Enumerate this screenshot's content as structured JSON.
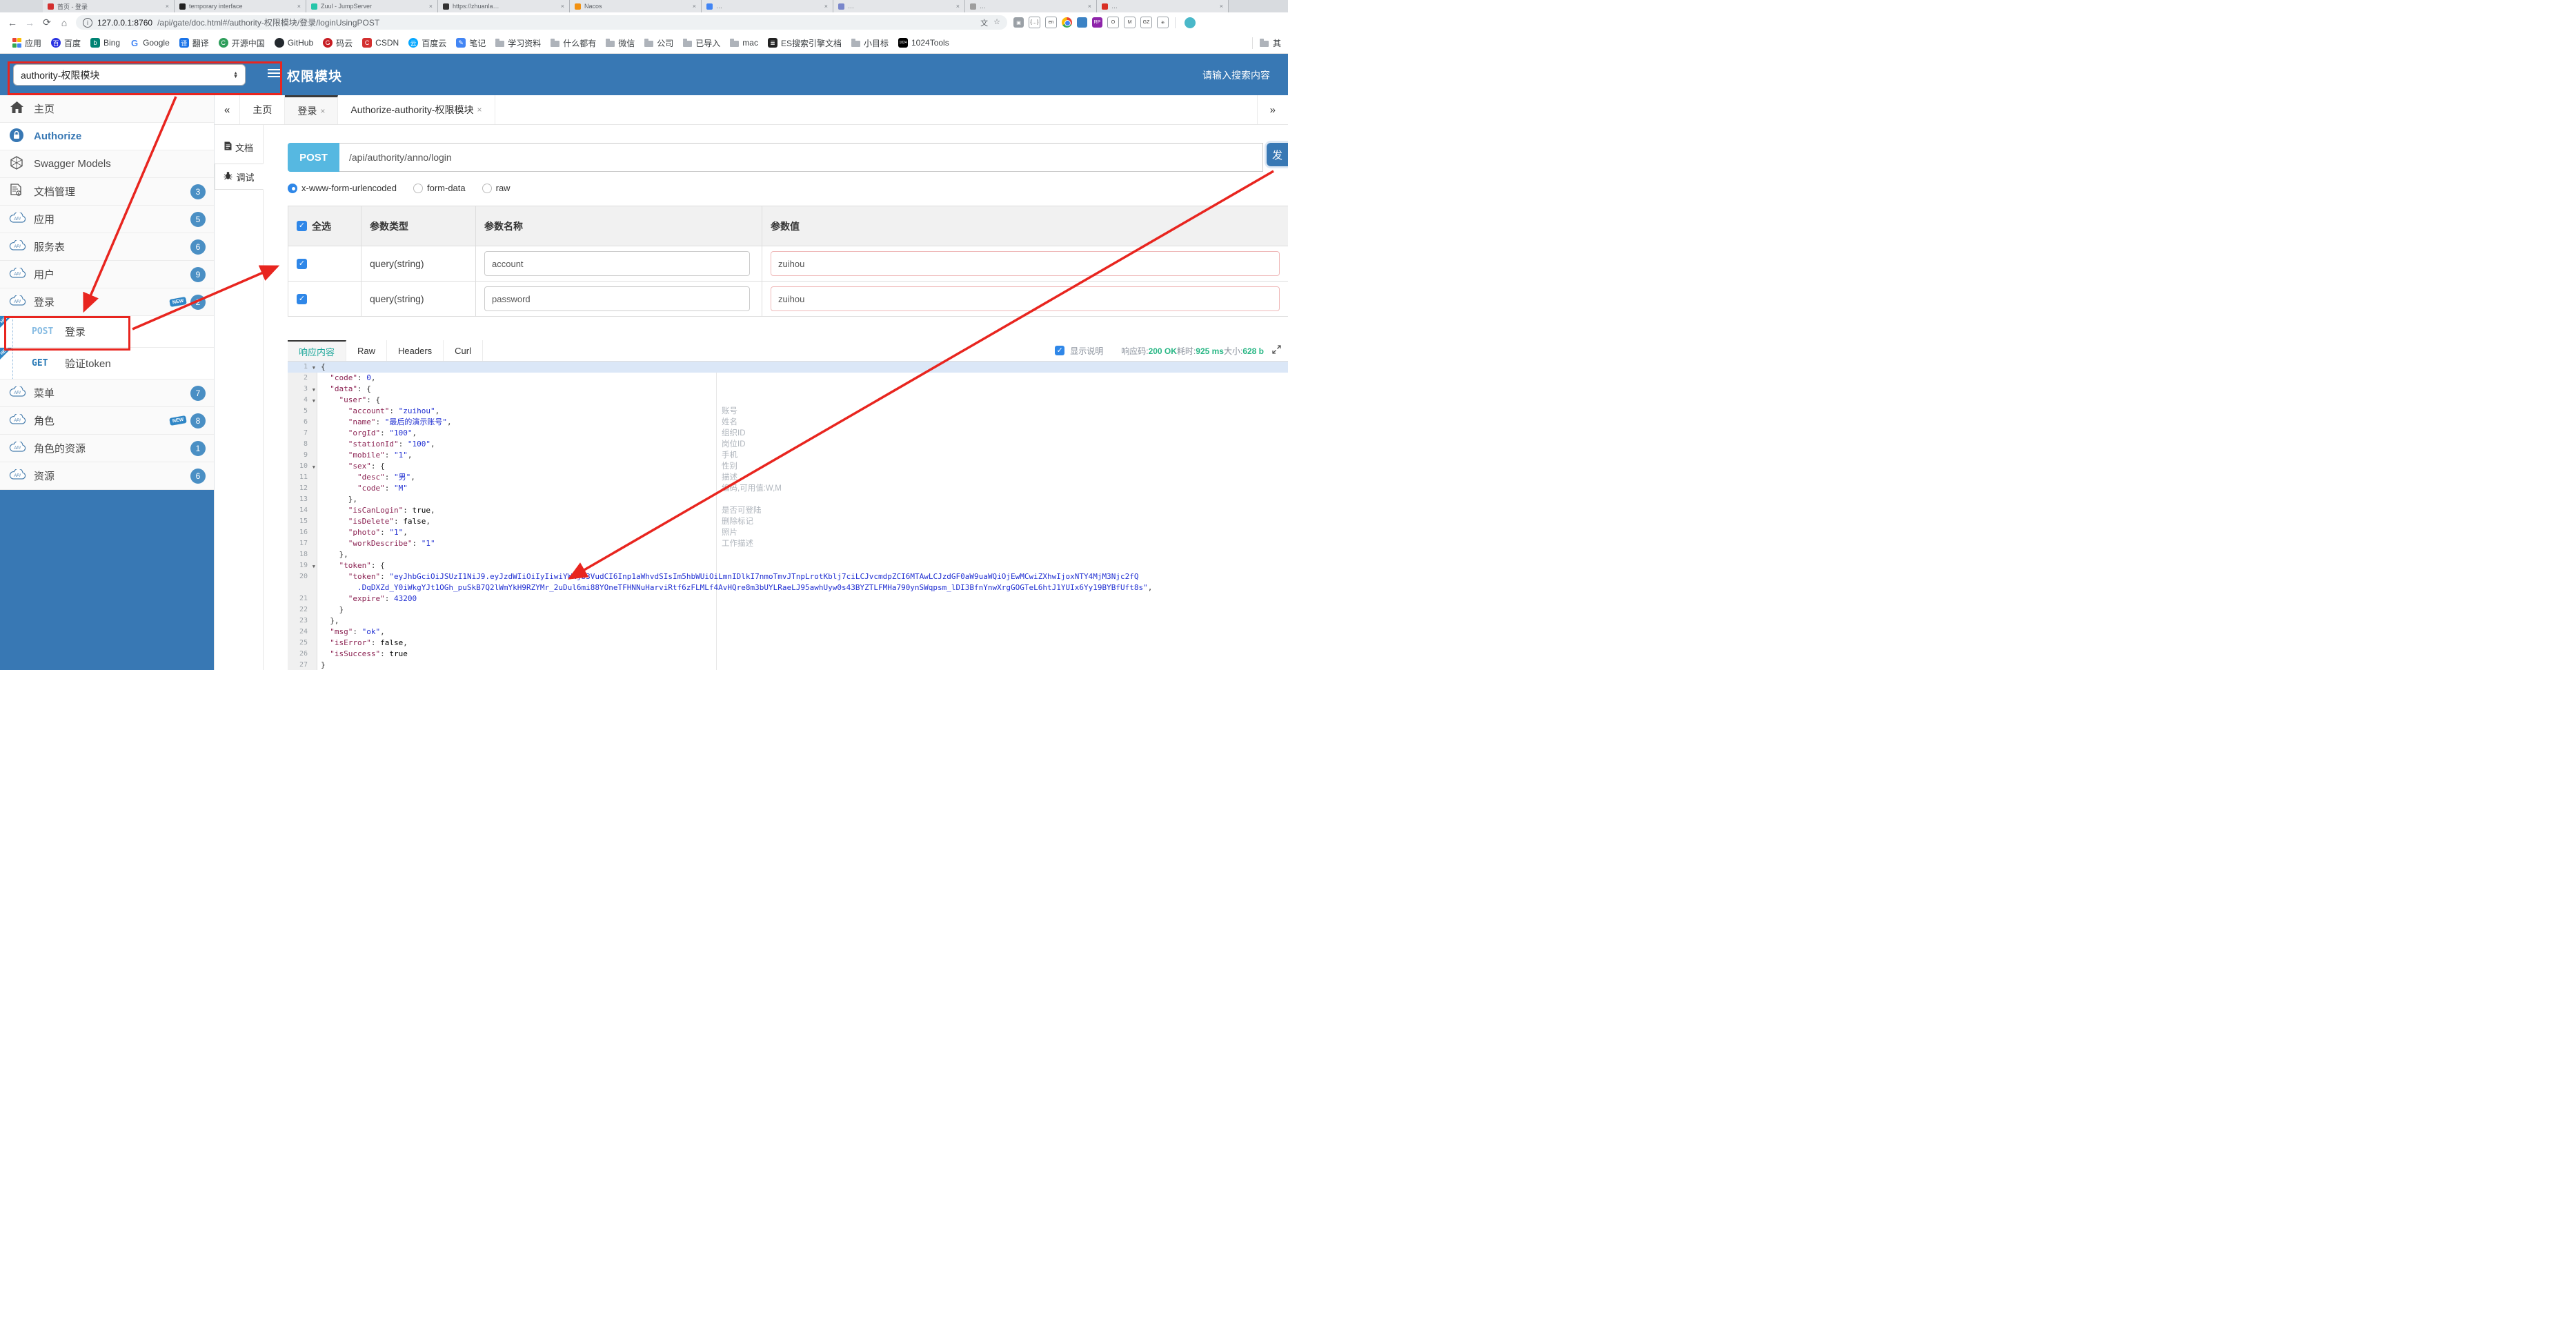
{
  "browser": {
    "tabs": [
      {
        "title": "首页 - 登录",
        "color": "#d32f2f"
      },
      {
        "title": "temporary interface",
        "color": "#222222"
      },
      {
        "title": "Zuul - JumpServer",
        "color": "#26c6aa"
      },
      {
        "title": "https://zhuanla…",
        "color": "#333333"
      },
      {
        "title": "Nacos",
        "color": "#f29111"
      },
      {
        "title": "…",
        "color": "#4285f4"
      },
      {
        "title": "…",
        "color": "#7986cb"
      },
      {
        "title": "…",
        "color": "#9e9e9e"
      },
      {
        "title": "…",
        "color": "#d93025"
      }
    ],
    "close_glyph": "×",
    "nav": {
      "back": "←",
      "forward": "→",
      "reload": "⟳",
      "home": "⌂"
    },
    "url_info": "i",
    "url_host": "127.0.0.1:8760",
    "url_path": "/api/gate/doc.html#/authority-权限模块/登录/loginUsingPOST",
    "translate_icon": "文",
    "star_icon": "☆",
    "extensions": [
      {
        "ch": "▣",
        "bg": "#9aa0a6",
        "style": "fill"
      },
      {
        "ch": "{…}",
        "bg": "",
        "style": "line"
      },
      {
        "ch": "en",
        "bg": "",
        "style": "line"
      },
      {
        "ch": "",
        "bg": "",
        "style": "ball"
      },
      {
        "ch": "",
        "bg": "#3b82c4",
        "style": "fill"
      },
      {
        "ch": "RP",
        "bg": "#8e24aa",
        "style": "fill"
      },
      {
        "ch": "O",
        "bg": "",
        "style": "line"
      },
      {
        "ch": "M",
        "bg": "",
        "style": "line"
      },
      {
        "ch": "GZ",
        "bg": "",
        "style": "line"
      },
      {
        "ch": "✳",
        "bg": "",
        "style": "line"
      }
    ],
    "bookmarks": [
      {
        "t": "grid",
        "label": "应用"
      },
      {
        "t": "circ",
        "bg": "#2932e1",
        "ch": "百",
        "label": "百度"
      },
      {
        "t": "sq",
        "bg": "#008373",
        "ch": "b",
        "label": "Bing"
      },
      {
        "t": "g",
        "ch": "G",
        "label": "Google"
      },
      {
        "t": "sq",
        "bg": "#1a73e8",
        "ch": "译",
        "label": "翻译"
      },
      {
        "t": "circ",
        "bg": "#2e9e5b",
        "ch": "C",
        "label": "开源中国"
      },
      {
        "t": "circ",
        "bg": "#24292e",
        "ch": "",
        "label": "GitHub"
      },
      {
        "t": "circ",
        "bg": "#c71d23",
        "ch": "G",
        "label": "码云"
      },
      {
        "t": "sq",
        "bg": "#d32f2f",
        "ch": "C",
        "label": "CSDN"
      },
      {
        "t": "circ",
        "bg": "#06a7ff",
        "ch": "云",
        "label": "百度云"
      },
      {
        "t": "sq",
        "bg": "#4285f4",
        "ch": "✎",
        "label": "笔记"
      },
      {
        "t": "folder",
        "label": "学习资料"
      },
      {
        "t": "folder",
        "label": "什么都有"
      },
      {
        "t": "folder",
        "label": "微信"
      },
      {
        "t": "folder",
        "label": "公司"
      },
      {
        "t": "folder",
        "label": "已导入"
      },
      {
        "t": "folder",
        "label": "mac"
      },
      {
        "t": "sq",
        "bg": "#222222",
        "ch": "≣",
        "label": "ES搜索引擎文档"
      },
      {
        "t": "folder",
        "label": "小目标"
      },
      {
        "t": "sq",
        "bg": "#000000",
        "ch": "1024",
        "label": "1024Tools"
      }
    ],
    "bookmarks_overflow": "其"
  },
  "header": {
    "module_select": "authority-权限模块",
    "title": "权限模块",
    "search_placeholder": "请输入搜索内容"
  },
  "sidebar": {
    "items": [
      {
        "kind": "home",
        "label": "主页"
      },
      {
        "kind": "lock",
        "label": "Authorize"
      },
      {
        "kind": "hex",
        "label": "Swagger Models"
      },
      {
        "kind": "doc",
        "label": "文档管理",
        "badge": "3"
      },
      {
        "kind": "api",
        "label": "应用",
        "badge": "5"
      },
      {
        "kind": "api",
        "label": "服务表",
        "badge": "6"
      },
      {
        "kind": "api",
        "label": "用户",
        "badge": "9"
      },
      {
        "kind": "api",
        "label": "登录",
        "badge": "2",
        "new": true
      },
      {
        "kind": "op",
        "method": "POST",
        "label": "登录",
        "ribbon": "NEW"
      },
      {
        "kind": "op",
        "method": "GET",
        "label": "验证token",
        "ribbon": "NEW"
      },
      {
        "kind": "api",
        "label": "菜单",
        "badge": "7"
      },
      {
        "kind": "api",
        "label": "角色",
        "badge": "8",
        "new": true
      },
      {
        "kind": "api",
        "label": "角色的资源",
        "badge": "1"
      },
      {
        "kind": "api",
        "label": "资源",
        "badge": "6"
      }
    ]
  },
  "content_tabs": {
    "collapse": "«",
    "expand": "»",
    "items": [
      {
        "label": "主页",
        "closable": false,
        "active": false
      },
      {
        "label": "登录",
        "closable": true,
        "active": true
      },
      {
        "label": "Authorize-authority-权限模块",
        "closable": true,
        "active": false
      }
    ],
    "close_glyph": "×"
  },
  "doc_tabs": [
    {
      "label": "文档",
      "active": false
    },
    {
      "label": "调试",
      "active": true
    }
  ],
  "debug": {
    "method": "POST",
    "path": "/api/authority/anno/login",
    "send_label": "发",
    "content_types": [
      {
        "label": "x-www-form-urlencoded",
        "selected": true
      },
      {
        "label": "form-data",
        "selected": false
      },
      {
        "label": "raw",
        "selected": false
      }
    ],
    "table": {
      "select_all_label": "全选",
      "headers": [
        "参数类型",
        "参数名称",
        "参数值"
      ],
      "check_glyph": "✓",
      "rows": [
        {
          "checked": true,
          "type": "query(string)",
          "name": "account",
          "value": "zuihou"
        },
        {
          "checked": true,
          "type": "query(string)",
          "name": "password",
          "value": "zuihou"
        }
      ]
    }
  },
  "response": {
    "tabs": [
      {
        "label": "响应内容",
        "active": true
      },
      {
        "label": "Raw",
        "active": false
      },
      {
        "label": "Headers",
        "active": false
      },
      {
        "label": "Curl",
        "active": false
      }
    ],
    "show_desc_label": "显示说明",
    "check_glyph": "✓",
    "meta": [
      {
        "label": "响应码:",
        "value": "200 OK"
      },
      {
        "label": "耗时:",
        "value": "925 ms"
      },
      {
        "label": "大小:",
        "value": "628 b"
      }
    ],
    "code_lines": [
      {
        "n": "1",
        "fold": true,
        "hl": true,
        "seg": [
          [
            "p",
            "{"
          ]
        ]
      },
      {
        "n": "2",
        "seg": [
          [
            "p",
            "  "
          ],
          [
            "k",
            "\"code\""
          ],
          [
            "p",
            ": "
          ],
          [
            "n",
            "0"
          ],
          [
            "p",
            ","
          ]
        ]
      },
      {
        "n": "3",
        "fold": true,
        "seg": [
          [
            "p",
            "  "
          ],
          [
            "k",
            "\"data\""
          ],
          [
            "p",
            ": {"
          ]
        ]
      },
      {
        "n": "4",
        "fold": true,
        "seg": [
          [
            "p",
            "    "
          ],
          [
            "k",
            "\"user\""
          ],
          [
            "p",
            ": {"
          ]
        ]
      },
      {
        "n": "5",
        "ann": "账号",
        "seg": [
          [
            "p",
            "      "
          ],
          [
            "k",
            "\"account\""
          ],
          [
            "p",
            ": "
          ],
          [
            "s",
            "\"zuihou\""
          ],
          [
            "p",
            ","
          ]
        ]
      },
      {
        "n": "6",
        "ann": "姓名",
        "seg": [
          [
            "p",
            "      "
          ],
          [
            "k",
            "\"name\""
          ],
          [
            "p",
            ": "
          ],
          [
            "s",
            "\"最后的演示账号\""
          ],
          [
            "p",
            ","
          ]
        ]
      },
      {
        "n": "7",
        "ann": "组织ID",
        "seg": [
          [
            "p",
            "      "
          ],
          [
            "k",
            "\"orgId\""
          ],
          [
            "p",
            ": "
          ],
          [
            "s",
            "\"100\""
          ],
          [
            "p",
            ","
          ]
        ]
      },
      {
        "n": "8",
        "ann": "岗位ID",
        "seg": [
          [
            "p",
            "      "
          ],
          [
            "k",
            "\"stationId\""
          ],
          [
            "p",
            ": "
          ],
          [
            "s",
            "\"100\""
          ],
          [
            "p",
            ","
          ]
        ]
      },
      {
        "n": "9",
        "ann": "手机",
        "seg": [
          [
            "p",
            "      "
          ],
          [
            "k",
            "\"mobile\""
          ],
          [
            "p",
            ": "
          ],
          [
            "s",
            "\"1\""
          ],
          [
            "p",
            ","
          ]
        ]
      },
      {
        "n": "10",
        "fold": true,
        "ann": "性别",
        "seg": [
          [
            "p",
            "      "
          ],
          [
            "k",
            "\"sex\""
          ],
          [
            "p",
            ": {"
          ]
        ]
      },
      {
        "n": "11",
        "ann": "描述",
        "seg": [
          [
            "p",
            "        "
          ],
          [
            "k",
            "\"desc\""
          ],
          [
            "p",
            ": "
          ],
          [
            "s",
            "\"男\""
          ],
          [
            "p",
            ","
          ]
        ]
      },
      {
        "n": "12",
        "ann": "编码,可用值:W,M",
        "seg": [
          [
            "p",
            "        "
          ],
          [
            "k",
            "\"code\""
          ],
          [
            "p",
            ": "
          ],
          [
            "s",
            "\"M\""
          ]
        ]
      },
      {
        "n": "13",
        "seg": [
          [
            "p",
            "      },"
          ]
        ]
      },
      {
        "n": "14",
        "ann": "是否可登陆",
        "seg": [
          [
            "p",
            "      "
          ],
          [
            "k",
            "\"isCanLogin\""
          ],
          [
            "p",
            ": "
          ],
          [
            "b",
            "true"
          ],
          [
            "p",
            ","
          ]
        ]
      },
      {
        "n": "15",
        "ann": "删除标记",
        "seg": [
          [
            "p",
            "      "
          ],
          [
            "k",
            "\"isDelete\""
          ],
          [
            "p",
            ": "
          ],
          [
            "b",
            "false"
          ],
          [
            "p",
            ","
          ]
        ]
      },
      {
        "n": "16",
        "ann": "照片",
        "seg": [
          [
            "p",
            "      "
          ],
          [
            "k",
            "\"photo\""
          ],
          [
            "p",
            ": "
          ],
          [
            "s",
            "\"1\""
          ],
          [
            "p",
            ","
          ]
        ]
      },
      {
        "n": "17",
        "ann": "工作描述",
        "seg": [
          [
            "p",
            "      "
          ],
          [
            "k",
            "\"workDescribe\""
          ],
          [
            "p",
            ": "
          ],
          [
            "s",
            "\"1\""
          ]
        ]
      },
      {
        "n": "18",
        "seg": [
          [
            "p",
            "    },"
          ]
        ]
      },
      {
        "n": "19",
        "fold": true,
        "seg": [
          [
            "p",
            "    "
          ],
          [
            "k",
            "\"token\""
          ],
          [
            "p",
            ": {"
          ]
        ]
      },
      {
        "n": "20",
        "seg": [
          [
            "p",
            "      "
          ],
          [
            "k",
            "\"token\""
          ],
          [
            "p",
            ": "
          ],
          [
            "s",
            "\"eyJhbGciOiJSUzI1NiJ9.eyJzdWIiOiIyIiwiYWNjb3VudCI6Inp1aWhvdSIsIm5hbWUiOiLmnIDlkI7nmoTmvJTnpLrotKblj7ciLCJvcmdpZCI6MTAwLCJzdGF0aW9uaWQiOjEwMCwiZXhwIjoxNTY4MjM3Njc2fQ"
          ]
        ]
      },
      {
        "n": "",
        "seg": [
          [
            "s",
            "        .DqDXZd_Y0iWkgYJt1OGh_puSkB7Q2lWmYkH9RZYMr_2uDul6mi88YOneTFHNNuHarviRtf6zFLMLf4AvHQre8m3bUYLRaeLJ95awhUyw0s43BYZTLFMHa790ynSWqpsm_lDI3BfnYnwXrgGOGTeL6htJ1YUIx6Yy19BYBfUft8s\""
          ],
          [
            "p",
            ","
          ]
        ]
      },
      {
        "n": "21",
        "seg": [
          [
            "p",
            "      "
          ],
          [
            "k",
            "\"expire\""
          ],
          [
            "p",
            ": "
          ],
          [
            "n",
            "43200"
          ]
        ]
      },
      {
        "n": "22",
        "seg": [
          [
            "p",
            "    }"
          ]
        ]
      },
      {
        "n": "23",
        "seg": [
          [
            "p",
            "  },"
          ]
        ]
      },
      {
        "n": "24",
        "seg": [
          [
            "p",
            "  "
          ],
          [
            "k",
            "\"msg\""
          ],
          [
            "p",
            ": "
          ],
          [
            "s",
            "\"ok\""
          ],
          [
            "p",
            ","
          ]
        ]
      },
      {
        "n": "25",
        "seg": [
          [
            "p",
            "  "
          ],
          [
            "k",
            "\"isError\""
          ],
          [
            "p",
            ": "
          ],
          [
            "b",
            "false"
          ],
          [
            "p",
            ","
          ]
        ]
      },
      {
        "n": "26",
        "seg": [
          [
            "p",
            "  "
          ],
          [
            "k",
            "\"isSuccess\""
          ],
          [
            "p",
            ": "
          ],
          [
            "b",
            "true"
          ]
        ]
      },
      {
        "n": "27",
        "seg": [
          [
            "p",
            "}"
          ]
        ]
      }
    ]
  },
  "colors": {
    "header_blue": "#3878b4",
    "badge_blue": "#4a8fc4",
    "post_badge": "#56b8e1",
    "active_resp_tab": "#1fa79b",
    "success_green": "#29b785",
    "annotation_red": "#e8251f"
  }
}
